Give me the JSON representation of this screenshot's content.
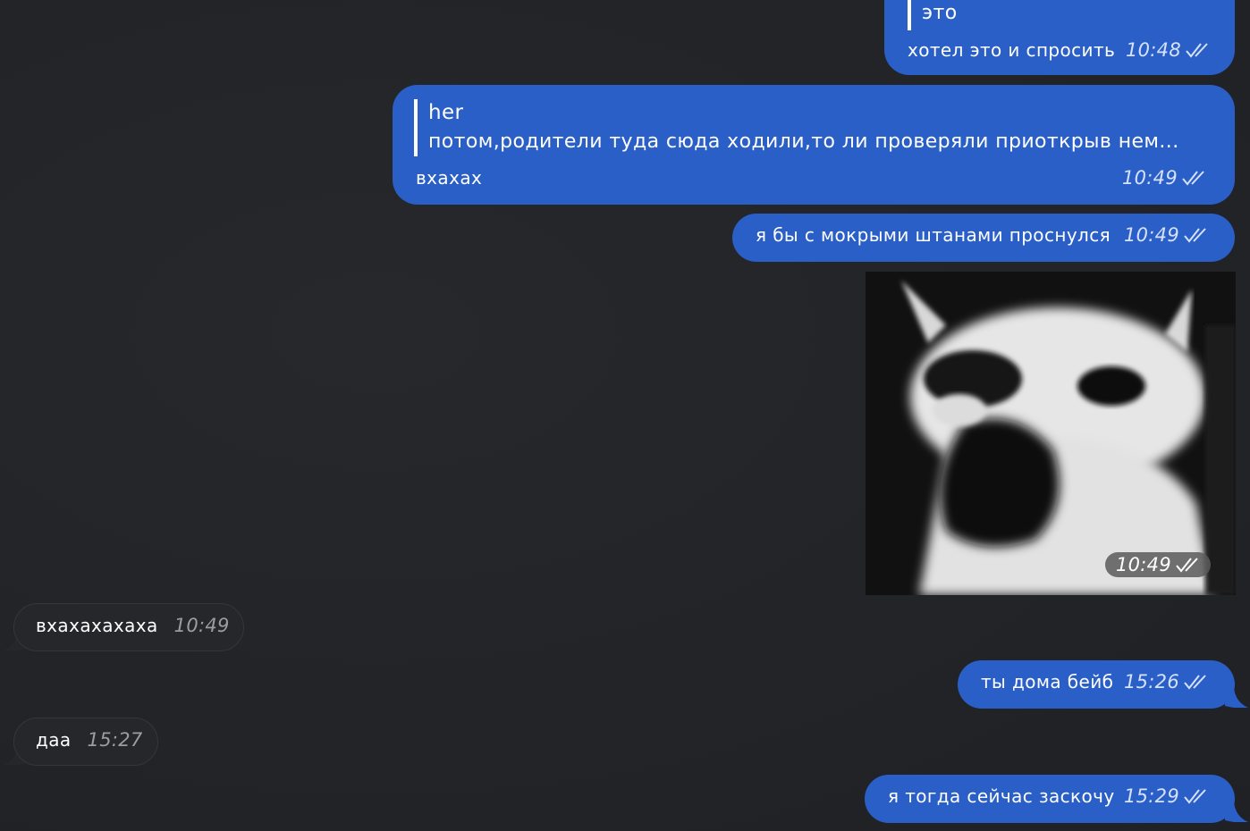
{
  "messages": [
    {
      "quote_text": "это",
      "text": "хотел это и спросить",
      "time": "10:48"
    },
    {
      "quote_author": "her",
      "quote_text": "потом,родители туда сюда ходили,то ли проверяли приоткрыв нем...",
      "text": "вхахах",
      "time": "10:49"
    },
    {
      "text": "я бы с мокрыми штанами проснулся",
      "time": "10:49"
    },
    {
      "media_time": "10:49"
    },
    {
      "text": "вхахахахаха",
      "time": "10:49"
    },
    {
      "text": "ты дома бейб",
      "time": "15:26"
    },
    {
      "text": "даа",
      "time": "15:27"
    },
    {
      "text": "я тогда сейчас заскочу",
      "time": "15:29"
    }
  ],
  "colors": {
    "background": "#222428",
    "outgoing_bubble": "#2a5fc8",
    "incoming_bubble": "#26272b"
  },
  "icons": {
    "read_status": "double-check-icon"
  }
}
